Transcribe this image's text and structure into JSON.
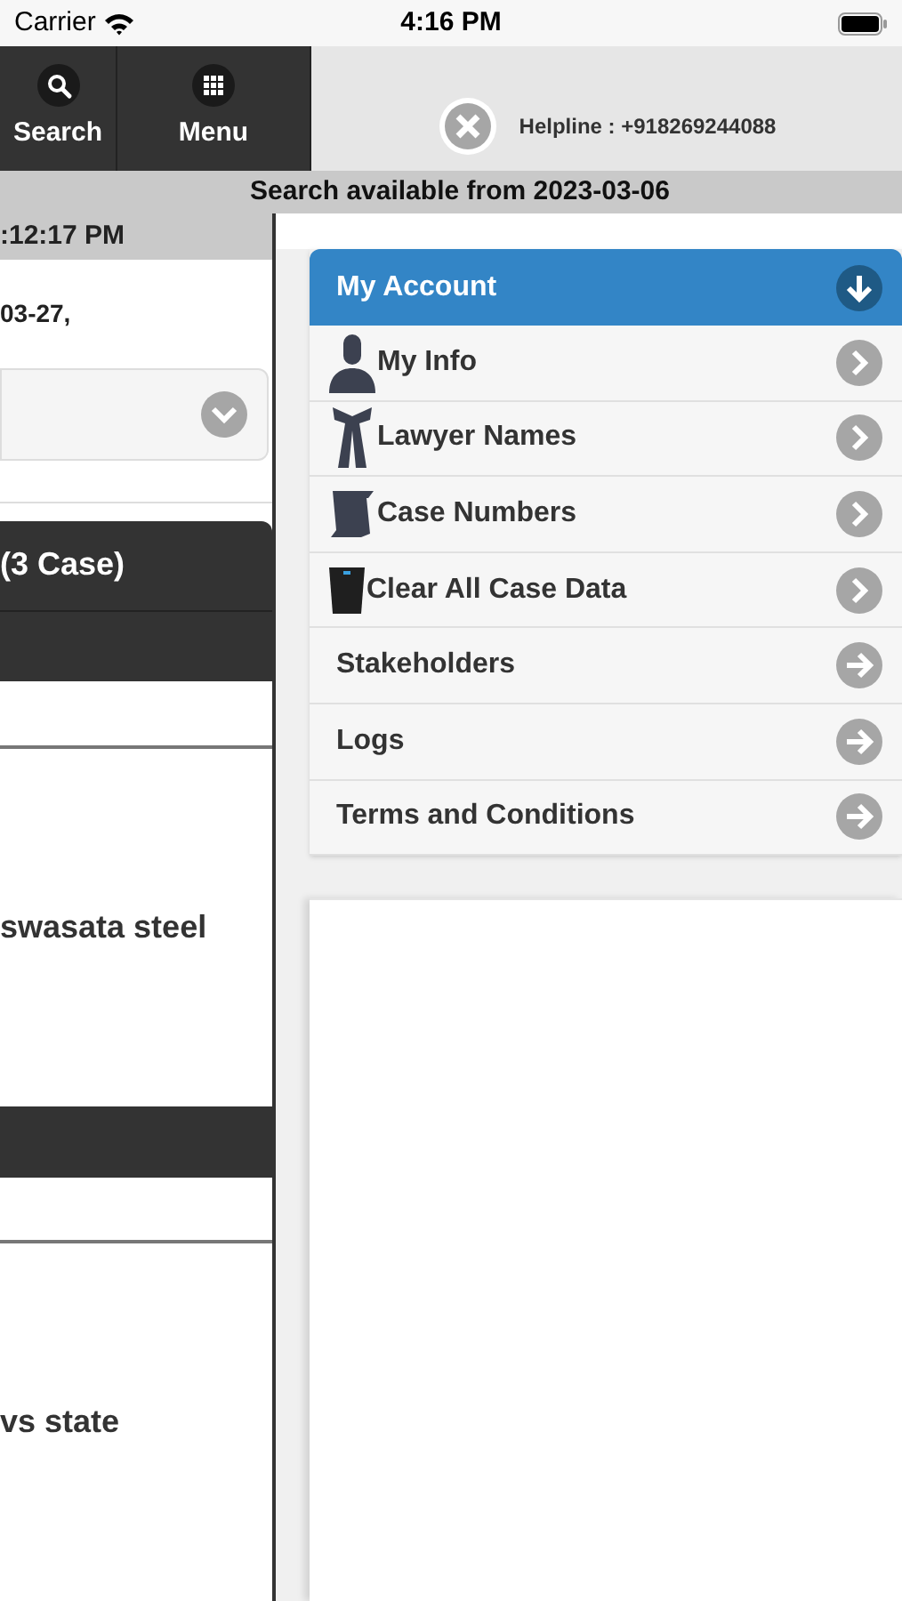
{
  "status_bar": {
    "carrier": "Carrier",
    "time": "4:16 PM"
  },
  "nav_buttons": [
    {
      "label": "Search"
    },
    {
      "label": "Menu"
    }
  ],
  "helpline": "Helpline : +918269244088",
  "banner": "Search available from 2023-03-06",
  "left_page": {
    "time_bar": ":12:17 PM",
    "date_text": "03-27,",
    "group_title": "(3 Case)",
    "cases": [
      {
        "title": "swasata steel"
      },
      {
        "title": "vs state"
      }
    ]
  },
  "menu": {
    "title": "My Account",
    "expanded": true,
    "items": [
      {
        "label": "My Info",
        "kind": "icon"
      },
      {
        "label": "Lawyer Names",
        "kind": "icon"
      },
      {
        "label": "Case Numbers",
        "kind": "icon"
      },
      {
        "label": "Clear All Case Data",
        "kind": "icon"
      },
      {
        "label": "Stakeholders",
        "kind": "plain"
      },
      {
        "label": "Logs",
        "kind": "plain"
      },
      {
        "label": "Terms and Conditions",
        "kind": "plain"
      }
    ]
  }
}
